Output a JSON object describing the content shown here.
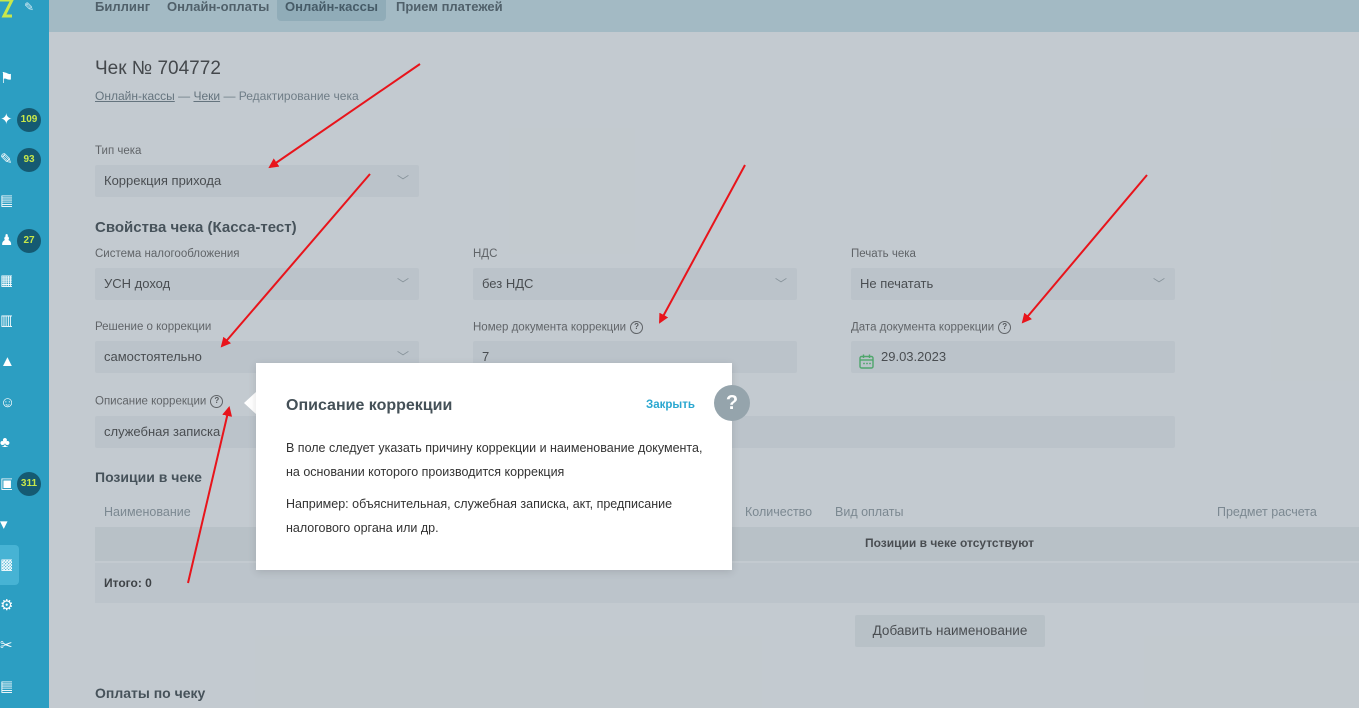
{
  "topnav": {
    "tabs": [
      {
        "label": "Биллинг"
      },
      {
        "label": "Онлайн-оплаты"
      },
      {
        "label": "Онлайн-кассы"
      },
      {
        "label": "Прием платежей"
      }
    ]
  },
  "sidebar": {
    "badges": [
      "109",
      "93",
      "27",
      "311"
    ]
  },
  "page": {
    "title": "Чек № 704772",
    "breadcrumb": {
      "item1": "Онлайн-кассы",
      "sep": "—",
      "item2": "Чеки",
      "current": "Редактирование чека"
    }
  },
  "receipt_type": {
    "label": "Тип чека",
    "value": "Коррекция прихода"
  },
  "properties": {
    "title": "Свойства чека (Касса-тест)",
    "tax_system": {
      "label": "Система налогообложения",
      "value": "УСН доход"
    },
    "vat": {
      "label": "НДС",
      "value": "без НДС"
    },
    "print": {
      "label": "Печать чека",
      "value": "Не печатать"
    },
    "decision": {
      "label": "Решение о коррекции",
      "value": "самостоятельно"
    },
    "doc_number": {
      "label": "Номер документа коррекции",
      "value": "7"
    },
    "doc_date": {
      "label": "Дата документа коррекции",
      "value": "29.03.2023"
    },
    "description": {
      "label": "Описание коррекции",
      "value": "служебная записка"
    }
  },
  "positions": {
    "title": "Позиции в чеке",
    "headers": {
      "name": "Наименование",
      "qty": "Количество",
      "payment": "Вид оплаты",
      "subject": "Предмет расчета"
    },
    "empty": "Позиции в чеке отсутствуют",
    "total": "Итого: 0",
    "add_button": "Добавить наименование"
  },
  "payments": {
    "title": "Оплаты по чеку"
  },
  "popup": {
    "title": "Описание коррекции",
    "close": "Закрыть",
    "text1": "В поле следует указать причину коррекции и наименование документа, на основании которого производится коррекция",
    "text2": "Например: объяснительная, служебная записка, акт, предписание налогового органа или др.",
    "help": "?"
  },
  "colors": {
    "sidebar": "#2c9ec2",
    "accent": "#2aa7d0",
    "arrow": "#e8141b"
  }
}
